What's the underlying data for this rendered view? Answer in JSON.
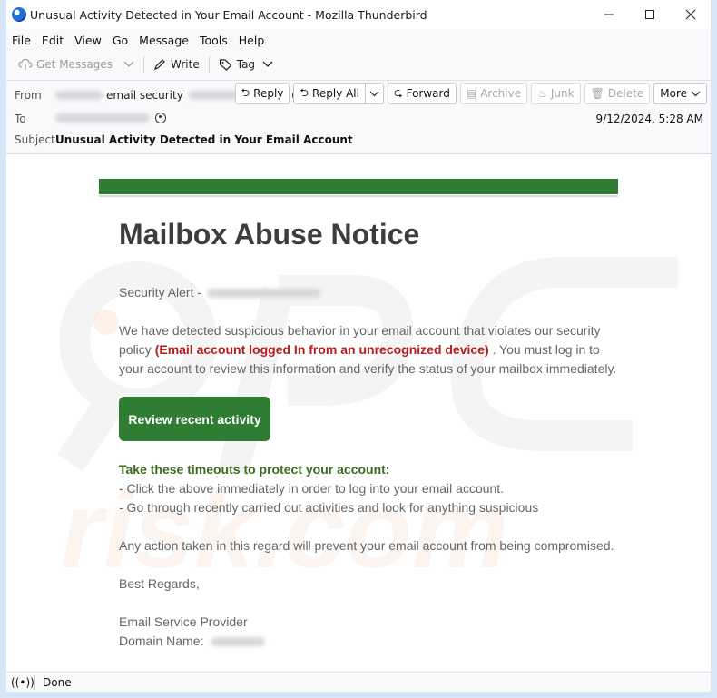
{
  "window": {
    "title": "Unusual Activity Detected in Your Email Account - Mozilla Thunderbird"
  },
  "menu": [
    "File",
    "Edit",
    "View",
    "Go",
    "Message",
    "Tools",
    "Help"
  ],
  "toolbar": {
    "get_messages": "Get Messages",
    "write": "Write",
    "tag": "Tag"
  },
  "header": {
    "from_label": "From",
    "from_name": "email security",
    "to_label": "To",
    "subject_label": "Subject",
    "subject": "Unusual Activity Detected in Your Email Account",
    "date": "9/12/2024, 5:28 AM",
    "buttons": {
      "reply": "Reply",
      "reply_all": "Reply All",
      "forward": "Forward",
      "archive": "Archive",
      "junk": "Junk",
      "delete": "Delete",
      "more": "More"
    }
  },
  "email": {
    "heading": "Mailbox Abuse Notice",
    "alert_prefix": "Security Alert -",
    "para1_a": "We have detected suspicious behavior in your email account that violates our security policy",
    "para1_highlight": "(Email account logged In from an unrecognized device)",
    "para1_b": ". You must log in to your account to review this information and verify the status of your mailbox immediately.",
    "cta": "Review recent activity",
    "timeouts_heading": "Take these timeouts to protect your account:",
    "timeouts": [
      "- Click the above immediately in order to log into your email account.",
      "- Go through recently carried out activities and look for anything suspicious"
    ],
    "action_note": "Any action taken in this regard will prevent your email account from being compromised.",
    "regards": "Best Regards,",
    "signature": "Email Service Provider",
    "domain_label": "Domain Name:",
    "colors": {
      "brand_green": "#2e7d32",
      "alert_red": "#b71c1c",
      "heading_green": "#3b6b1f"
    }
  },
  "status": {
    "text": "Done"
  }
}
